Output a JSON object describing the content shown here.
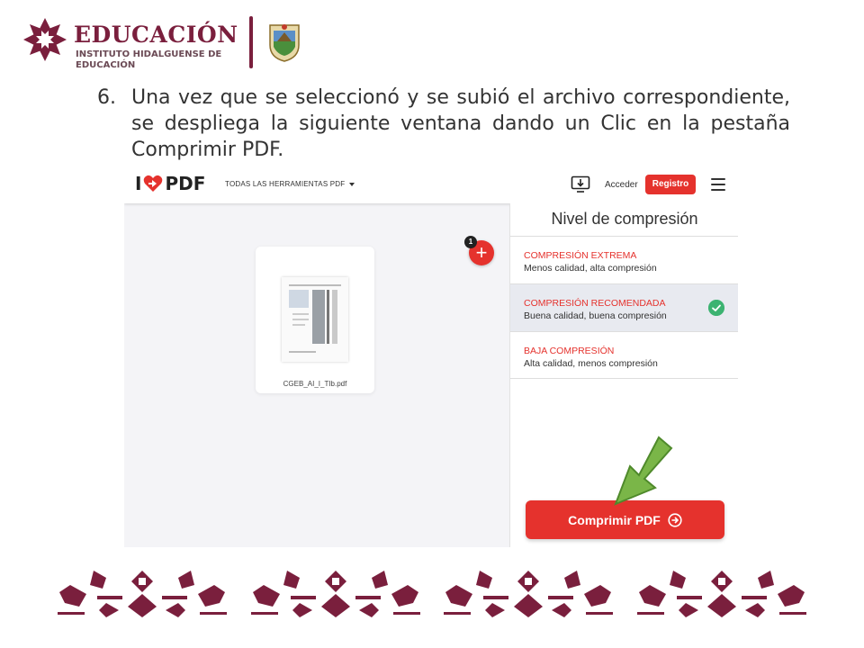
{
  "header": {
    "title": "EDUCACIÓN",
    "subtitle": "INSTITUTO HIDALGUENSE DE EDUCACIÓN",
    "colors": {
      "brand": "#7a1f3d"
    }
  },
  "instruction": {
    "number": "6.",
    "text": "Una vez que se seleccionó y se subió el archivo correspondiente, se despliega la siguiente ventana dando un Clic en la pestaña Comprimir PDF."
  },
  "app": {
    "brand_prefix": "I",
    "brand_suffix": "PDF",
    "tools_menu": "TODAS LAS HERRAMIENTAS PDF",
    "login": "Acceder",
    "register": "Registro",
    "accent": "#e5322d",
    "file": {
      "name": "CGEB_AI_I_TIb.pdf",
      "badge_count": "1"
    },
    "panel": {
      "title": "Nivel de compresión",
      "options": [
        {
          "name": "COMPRESIÓN EXTREMA",
          "desc": "Menos calidad, alta compresión",
          "selected": false
        },
        {
          "name": "COMPRESIÓN RECOMENDADA",
          "desc": "Buena calidad, buena compresión",
          "selected": true
        },
        {
          "name": "BAJA COMPRESIÓN",
          "desc": "Alta calidad, menos compresión",
          "selected": false
        }
      ],
      "action": "Comprimir PDF"
    }
  }
}
